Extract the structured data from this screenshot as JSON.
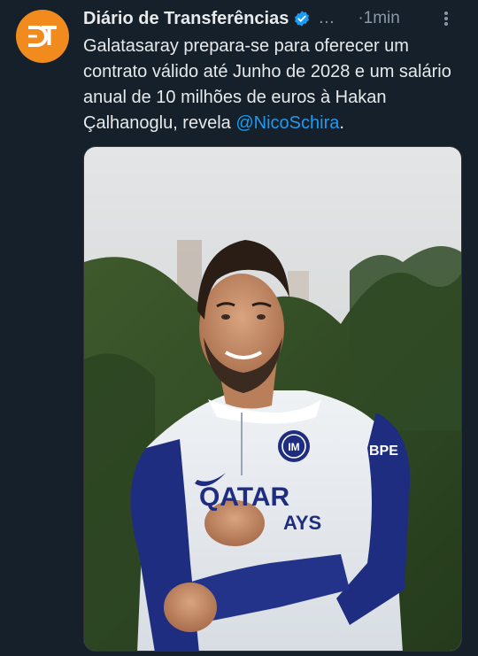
{
  "account": {
    "display_name": "Diário de Transferências",
    "handle_truncated": "…",
    "time_sep": "·",
    "time": "1min",
    "avatar_initials": "DT",
    "verified": true
  },
  "tweet": {
    "text_main": "Galatasaray prepara-se para oferecer um contrato válido até Junho de 2028 e um salário anual de 10 milhões de euros à Hakan Çalhanoglu, revela ",
    "mention": "@NicoSchira",
    "text_end": "."
  },
  "photo": {
    "jersey_sponsor_line1": "QATAR",
    "jersey_sponsor_line2": "AYS",
    "sleeve_text": "BPE",
    "crest_text": "IM"
  },
  "colors": {
    "background": "#15202b",
    "brand_orange": "#f28b1e",
    "link_blue": "#1d9bf0",
    "verified_blue": "#1d9bf0",
    "muted": "#8b98a5"
  },
  "icons": {
    "more": "more-vertical-icon",
    "verified": "verified-badge-icon"
  }
}
